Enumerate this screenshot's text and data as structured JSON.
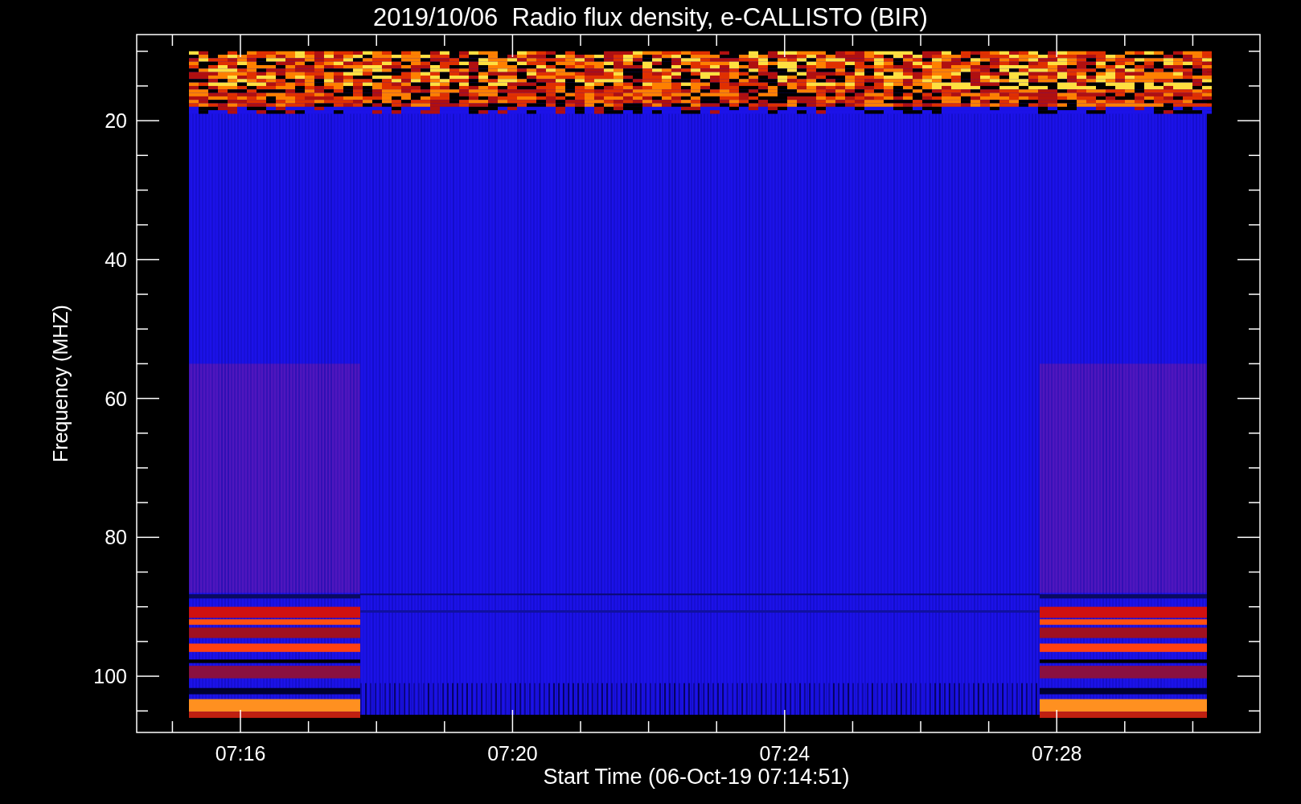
{
  "title": "2019/10/06  Radio flux density, e-CALLISTO (BIR)",
  "plot": {
    "xlabel": "Start Time (06-Oct-19 07:14:51)",
    "ylabel": "Frequency (MHZ)",
    "yticks": [
      "20",
      "40",
      "60",
      "80",
      "100"
    ],
    "xticks": [
      "07:16",
      "07:20",
      "07:24",
      "07:28"
    ]
  }
}
